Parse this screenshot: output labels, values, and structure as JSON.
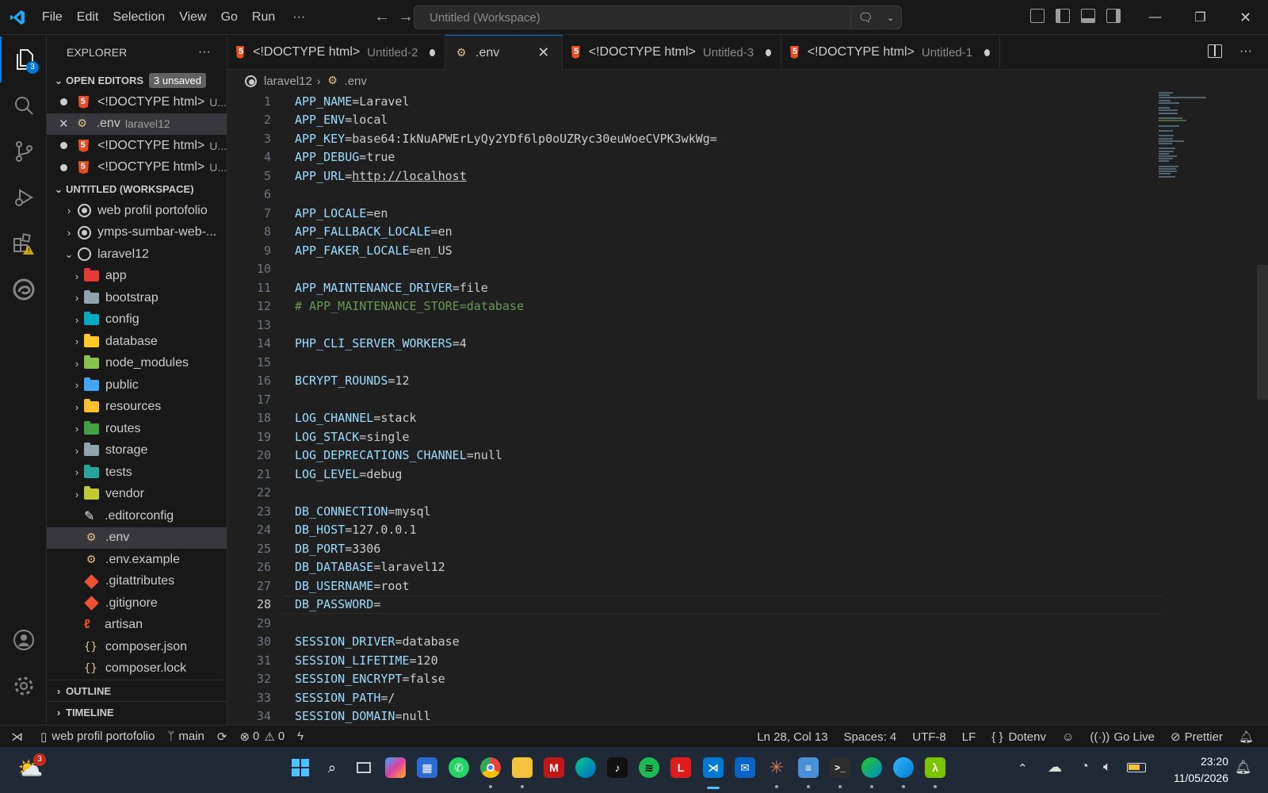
{
  "menu": [
    "File",
    "Edit",
    "Selection",
    "View",
    "Go",
    "Run",
    "···"
  ],
  "command_center": {
    "text": "Untitled (Workspace)"
  },
  "explorer": {
    "title": "EXPLORER",
    "more": "···",
    "open_editors": {
      "title": "OPEN EDITORS",
      "badge": "3 unsaved",
      "items": [
        {
          "name": "<!DOCTYPE html>",
          "desc": "U..."
        },
        {
          "name": ".env",
          "desc": "laravel12"
        },
        {
          "name": "<!DOCTYPE html>",
          "desc": "U..."
        },
        {
          "name": "<!DOCTYPE html>",
          "desc": "U..."
        }
      ]
    },
    "workspace": {
      "title": "UNTITLED (WORKSPACE)",
      "roots": [
        "web profil portofolio",
        "ymps-sumbar-web-...",
        "laravel12"
      ],
      "folders": [
        "app",
        "bootstrap",
        "config",
        "database",
        "node_modules",
        "public",
        "resources",
        "routes",
        "storage",
        "tests",
        "vendor"
      ],
      "files": [
        ".editorconfig",
        ".env",
        ".env.example",
        ".gitattributes",
        ".gitignore",
        "artisan",
        "composer.json",
        "composer.lock"
      ]
    },
    "outline": "OUTLINE",
    "timeline": "TIMELINE"
  },
  "activity_badge": "3",
  "tabs": [
    {
      "name": "<!DOCTYPE html>",
      "desc": "Untitled-2",
      "active": false
    },
    {
      "name": ".env",
      "desc": "",
      "active": true
    },
    {
      "name": "<!DOCTYPE html>",
      "desc": "Untitled-3",
      "active": false
    },
    {
      "name": "<!DOCTYPE html>",
      "desc": "Untitled-1",
      "active": false
    }
  ],
  "breadcrumb": {
    "folder": "laravel12",
    "file": ".env"
  },
  "editor": {
    "current_line": 28,
    "lines": [
      {
        "n": "1",
        "key": "APP_NAME",
        "val": "Laravel"
      },
      {
        "n": "2",
        "key": "APP_ENV",
        "val": "local"
      },
      {
        "n": "3",
        "key": "APP_KEY",
        "val": "base64:IkNuAPWErLyQy2YDf6lp0oUZRyc30euWoeCVPK3wkWg="
      },
      {
        "n": "4",
        "key": "APP_DEBUG",
        "val": "true"
      },
      {
        "n": "5",
        "key": "APP_URL",
        "val": "http://localhost",
        "link": true
      },
      {
        "n": "6"
      },
      {
        "n": "7",
        "key": "APP_LOCALE",
        "val": "en"
      },
      {
        "n": "8",
        "key": "APP_FALLBACK_LOCALE",
        "val": "en"
      },
      {
        "n": "9",
        "key": "APP_FAKER_LOCALE",
        "val": "en_US"
      },
      {
        "n": "10"
      },
      {
        "n": "11",
        "key": "APP_MAINTENANCE_DRIVER",
        "val": "file"
      },
      {
        "n": "12",
        "comment": "# APP_MAINTENANCE_STORE=database"
      },
      {
        "n": "13"
      },
      {
        "n": "14",
        "key": "PHP_CLI_SERVER_WORKERS",
        "val": "4"
      },
      {
        "n": "15"
      },
      {
        "n": "16",
        "key": "BCRYPT_ROUNDS",
        "val": "12"
      },
      {
        "n": "17"
      },
      {
        "n": "18",
        "key": "LOG_CHANNEL",
        "val": "stack"
      },
      {
        "n": "19",
        "key": "LOG_STACK",
        "val": "single"
      },
      {
        "n": "20",
        "key": "LOG_DEPRECATIONS_CHANNEL",
        "val": "null"
      },
      {
        "n": "21",
        "key": "LOG_LEVEL",
        "val": "debug"
      },
      {
        "n": "22"
      },
      {
        "n": "23",
        "key": "DB_CONNECTION",
        "val": "mysql"
      },
      {
        "n": "24",
        "key": "DB_HOST",
        "val": "127.0.0.1"
      },
      {
        "n": "25",
        "key": "DB_PORT",
        "val": "3306"
      },
      {
        "n": "26",
        "key": "DB_DATABASE",
        "val": "laravel12"
      },
      {
        "n": "27",
        "key": "DB_USERNAME",
        "val": "root"
      },
      {
        "n": "28",
        "key": "DB_PASSWORD",
        "val": ""
      },
      {
        "n": "29"
      },
      {
        "n": "30",
        "key": "SESSION_DRIVER",
        "val": "database"
      },
      {
        "n": "31",
        "key": "SESSION_LIFETIME",
        "val": "120"
      },
      {
        "n": "32",
        "key": "SESSION_ENCRYPT",
        "val": "false"
      },
      {
        "n": "33",
        "key": "SESSION_PATH",
        "val": "/"
      },
      {
        "n": "34",
        "key": "SESSION_DOMAIN",
        "val": "null"
      }
    ]
  },
  "statusbar": {
    "remote": "",
    "project": "web profil portofolio",
    "branch": "main",
    "errors": "0",
    "warnings": "0",
    "position": "Ln 28, Col 13",
    "spaces": "Spaces: 4",
    "encoding": "UTF-8",
    "eol": "LF",
    "language": "Dotenv",
    "golive": "Go Live",
    "prettier": "Prettier"
  },
  "taskbar": {
    "weather_badge": "3",
    "time": "23:20",
    "date": "11/05/2026"
  },
  "colors": {
    "accent": "#0078d4",
    "key": "#9cdcfe",
    "comment": "#6a9955",
    "html_icon": "#e44d26"
  }
}
